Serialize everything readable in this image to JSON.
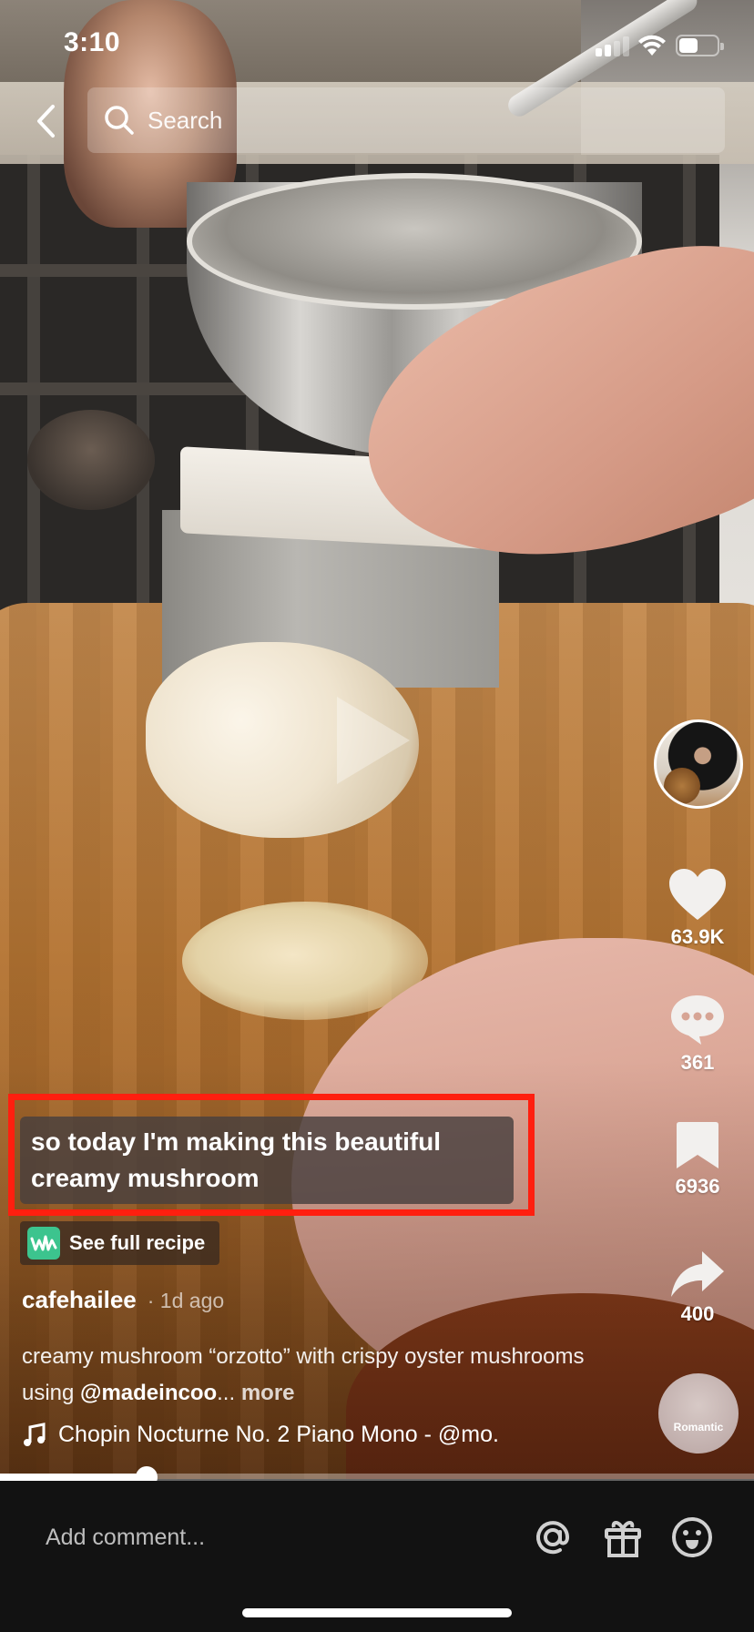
{
  "status_bar": {
    "time": "3:10",
    "signal_bars": 2,
    "signal_max": 4,
    "battery_percent": 55
  },
  "top_bar": {
    "back_icon": "chevron-left-icon",
    "search_icon": "search-icon",
    "search_placeholder": "Search"
  },
  "video": {
    "play_icon": "play-icon",
    "progress": 0.195
  },
  "actions": {
    "avatar_icon": "creator-avatar",
    "like": {
      "icon": "heart-icon",
      "count": "63.9K"
    },
    "comment": {
      "icon": "comment-bubble-icon",
      "count": "361"
    },
    "bookmark": {
      "icon": "bookmark-icon",
      "count": "6936"
    },
    "share": {
      "icon": "share-arrow-icon",
      "count": "400"
    },
    "sound_disc_label": "Romantic"
  },
  "caption": {
    "text": "so today I'm making this beautiful creamy mushroom",
    "highlight_color": "#ff1f0f"
  },
  "recipe_chip": {
    "icon": "recipe-app-icon",
    "label": "See full recipe",
    "icon_color": "#3cc48e"
  },
  "post": {
    "author": "cafehailee",
    "timestamp": "· 1d ago",
    "description_part1": "creamy mushroom “orzotto” with crispy oyster mushrooms using ",
    "mention": "@madeincoo",
    "ellipsis": "...",
    "more_label": " more",
    "music_icon": "music-note-icon",
    "music": "Chopin Nocturne No. 2 Piano Mono - @mo."
  },
  "comment_bar": {
    "placeholder": "Add comment...",
    "value": "",
    "icons": [
      "at-mention-icon",
      "gift-icon",
      "emoji-icon"
    ]
  }
}
